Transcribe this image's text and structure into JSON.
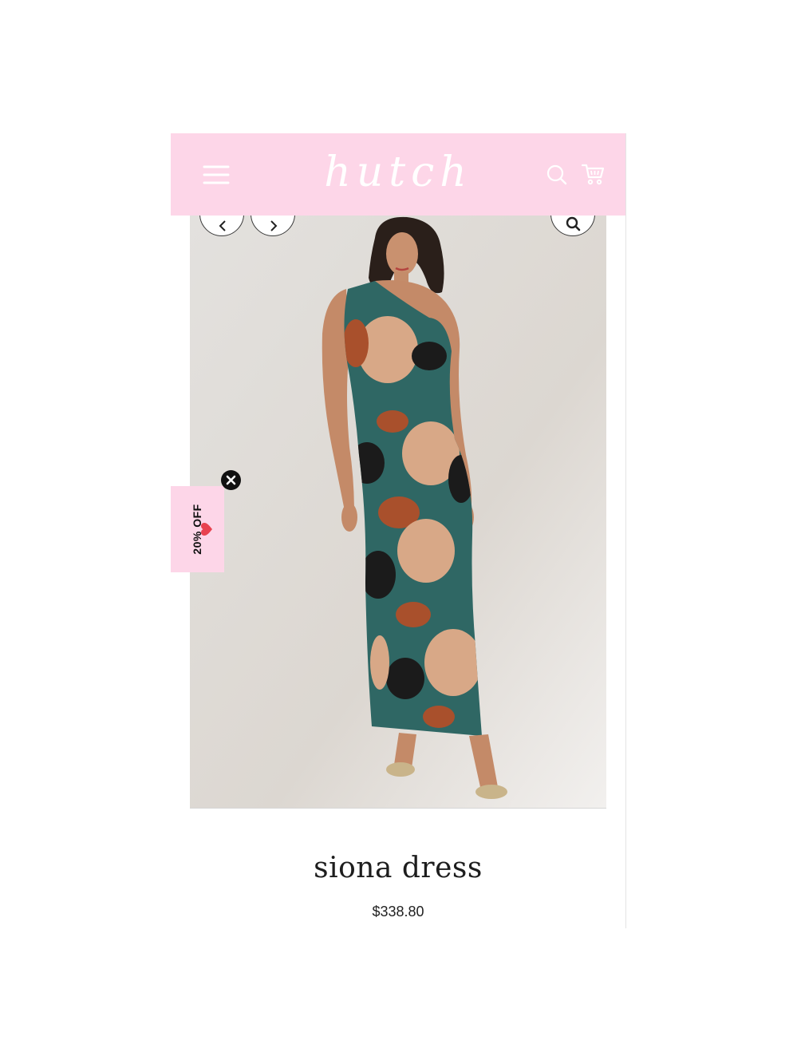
{
  "header": {
    "logo_text": "hutch",
    "background_color": "#fdd6e8",
    "menu_icon": "hamburger-menu-icon",
    "search_icon": "search-icon",
    "cart_icon": "shopping-cart-icon"
  },
  "gallery": {
    "prev_icon": "chevron-left-icon",
    "next_icon": "chevron-right-icon",
    "zoom_icon": "zoom-icon",
    "image_subject": "model wearing teal one-shoulder floral maxi dress"
  },
  "promo": {
    "label": "20% OFF",
    "heart_icon": "heart-icon",
    "close_icon": "close-icon",
    "background_color": "#fdd6e8"
  },
  "product": {
    "title": "siona dress",
    "price": "$338.80"
  }
}
